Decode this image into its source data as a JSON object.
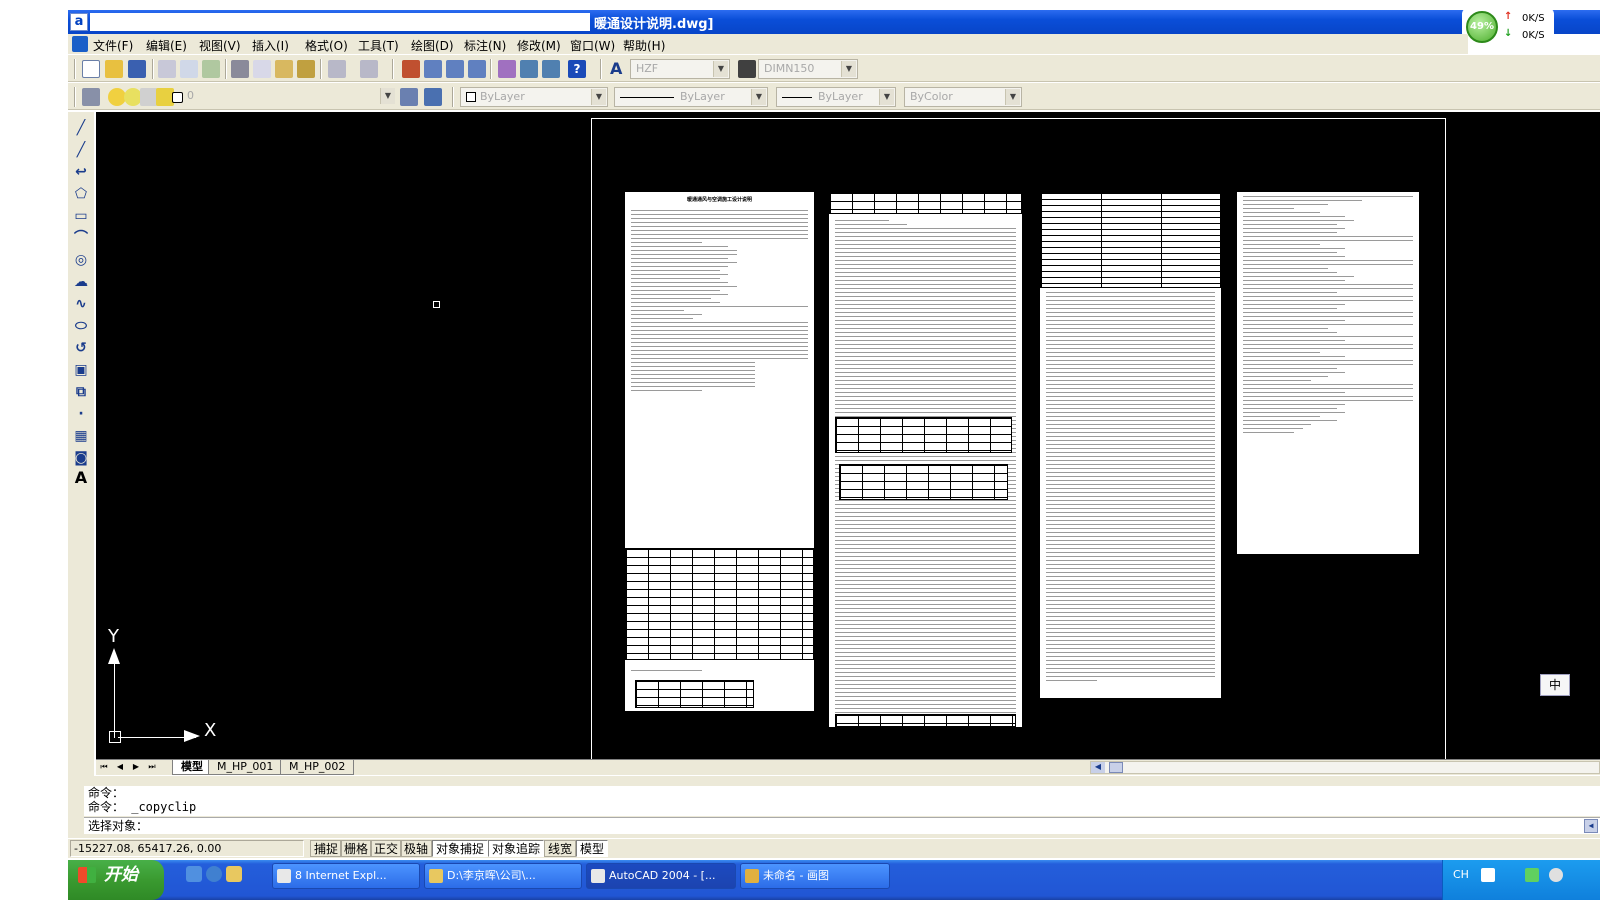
{
  "window": {
    "app_icon": "autocad-icon",
    "title": "暖通设计说明.dwg]"
  },
  "net_monitor": {
    "percent": "49%",
    "up_speed": "0K/S",
    "down_speed": "0K/S",
    "up_arrow": "↑",
    "down_arrow": "↓"
  },
  "menu": {
    "items": [
      "文件(F)",
      "编辑(E)",
      "视图(V)",
      "插入(I)",
      "格式(O)",
      "工具(T)",
      "绘图(D)",
      "标注(N)",
      "修改(M)",
      "窗口(W)",
      "帮助(H)"
    ]
  },
  "toolbar": {
    "text_style": "HZF",
    "dim_style": "DIMN150",
    "layer": "0",
    "color": "ByLayer",
    "linetype": "ByLayer",
    "lineweight": "ByLayer",
    "plot_style": "ByColor"
  },
  "drawing": {
    "sheet1_title": "暖通通风与空调施工设计说明",
    "ucs_y": "Y",
    "ucs_x": "X"
  },
  "tabs": {
    "items": [
      "模型",
      "M_HP_001",
      "M_HP_002"
    ],
    "active": "模型"
  },
  "command": {
    "history": [
      "命令：",
      "命令： _copyclip"
    ],
    "prompt": "选择对象："
  },
  "status": {
    "coords": "-15227.08, 65417.26, 0.00",
    "buttons": [
      "捕捉",
      "栅格",
      "正交",
      "极轴",
      "对象捕捉",
      "对象追踪",
      "线宽",
      "模型"
    ]
  },
  "taskbar": {
    "start": "开始",
    "tasks": [
      "8 Internet Expl...",
      "D:\\李京晖\\公司\\...",
      "AutoCAD 2004 - [...",
      "未命名 - 画图"
    ],
    "tray_lang": "CH",
    "ime": "中"
  }
}
